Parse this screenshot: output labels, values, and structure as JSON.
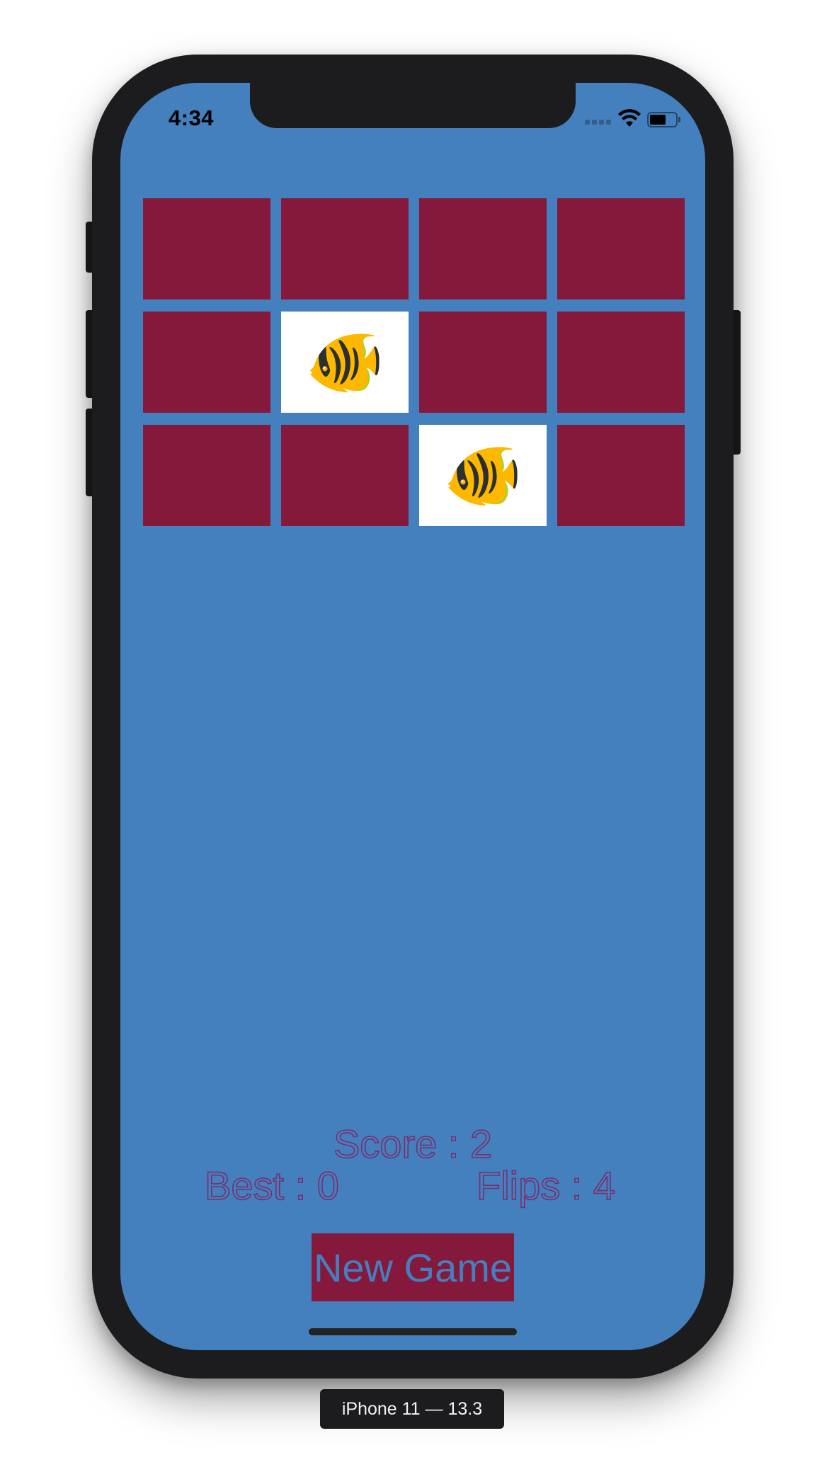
{
  "status_bar": {
    "time": "4:34"
  },
  "cards": [
    {
      "face_up": false,
      "emoji": ""
    },
    {
      "face_up": false,
      "emoji": ""
    },
    {
      "face_up": false,
      "emoji": ""
    },
    {
      "face_up": false,
      "emoji": ""
    },
    {
      "face_up": false,
      "emoji": ""
    },
    {
      "face_up": true,
      "emoji": "🐠"
    },
    {
      "face_up": false,
      "emoji": ""
    },
    {
      "face_up": false,
      "emoji": ""
    },
    {
      "face_up": false,
      "emoji": ""
    },
    {
      "face_up": false,
      "emoji": ""
    },
    {
      "face_up": true,
      "emoji": "🐠"
    },
    {
      "face_up": false,
      "emoji": ""
    }
  ],
  "stats": {
    "score": "Score : 2",
    "best": "Best : 0",
    "flips": "Flips : 4"
  },
  "new_game_label": "New Game",
  "device_label": "iPhone 11 — 13.3",
  "colors": {
    "background": "#447fbe",
    "card_back": "#85193c",
    "card_front": "#ffffff",
    "text_outline": "#7b2e6c"
  }
}
